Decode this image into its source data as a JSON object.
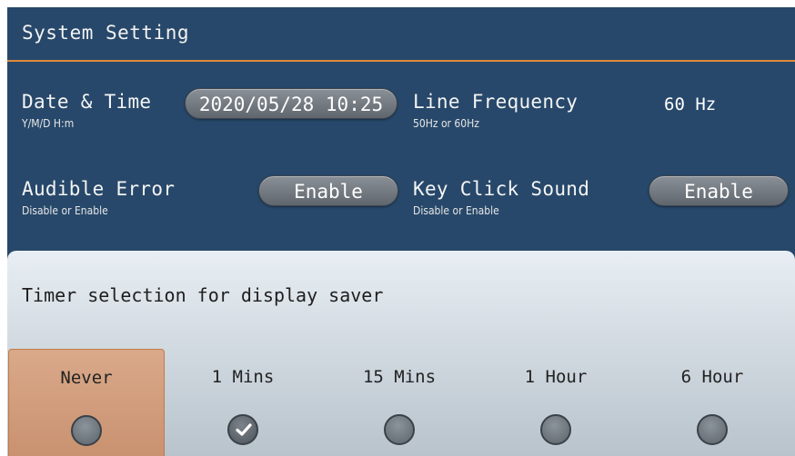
{
  "header": {
    "title": "System Setting"
  },
  "settings": {
    "date_time": {
      "label": "Date & Time",
      "hint": "Y/M/D H:m",
      "value": "2020/05/28 10:25"
    },
    "line_frequency": {
      "label": "Line Frequency",
      "hint": "50Hz or 60Hz",
      "value": "60 Hz"
    },
    "audible_error": {
      "label": "Audible Error",
      "hint": "Disable or Enable",
      "value": "Enable"
    },
    "key_click_sound": {
      "label": "Key Click Sound",
      "hint": "Disable or Enable",
      "value": "Enable"
    }
  },
  "display_saver": {
    "title": "Timer selection for display saver",
    "options": [
      {
        "label": "Never",
        "highlighted": true,
        "checked": false
      },
      {
        "label": "1 Mins",
        "highlighted": false,
        "checked": true
      },
      {
        "label": "15 Mins",
        "highlighted": false,
        "checked": false
      },
      {
        "label": "1 Hour",
        "highlighted": false,
        "checked": false
      },
      {
        "label": "6 Hour",
        "highlighted": false,
        "checked": false
      }
    ]
  },
  "colors": {
    "background": "#27486a",
    "accent_line": "#e0893a",
    "highlight": "#d9a98a"
  }
}
